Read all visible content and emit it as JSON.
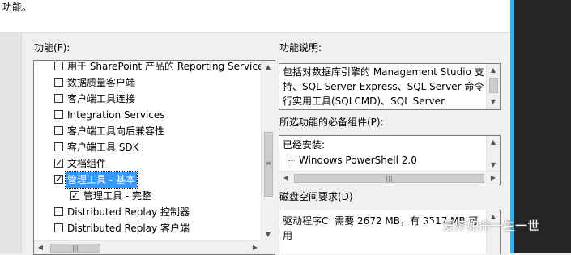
{
  "top_text": "功能。",
  "features_label": "功能(F):",
  "features": [
    {
      "label": "用于 SharePoint 产品的 Reporting Services",
      "checked": false,
      "indent": 0,
      "selected": false
    },
    {
      "label": "数据质量客户端",
      "checked": false,
      "indent": 0,
      "selected": false
    },
    {
      "label": "客户端工具连接",
      "checked": false,
      "indent": 0,
      "selected": false
    },
    {
      "label": "Integration Services",
      "checked": false,
      "indent": 0,
      "selected": false
    },
    {
      "label": "客户端工具向后兼容性",
      "checked": false,
      "indent": 0,
      "selected": false
    },
    {
      "label": "客户端工具 SDK",
      "checked": false,
      "indent": 0,
      "selected": false
    },
    {
      "label": "文档组件",
      "checked": true,
      "indent": 0,
      "selected": false
    },
    {
      "label": "管理工具 - 基本",
      "checked": true,
      "indent": 0,
      "selected": true
    },
    {
      "label": "管理工具 - 完整",
      "checked": true,
      "indent": 1,
      "selected": false
    },
    {
      "label": "Distributed Replay 控制器",
      "checked": false,
      "indent": 0,
      "selected": false
    },
    {
      "label": "Distributed Replay 客户端",
      "checked": false,
      "indent": 0,
      "selected": false
    }
  ],
  "description_label": "功能说明:",
  "description_lines": [
    "包括对数据库引擎的 Management Studio 支",
    "持、SQL Server Express、SQL Server 命令",
    "行实用工具(SQLCMD)、SQL Server"
  ],
  "prereq_label": "所选功能的必备组件(P):",
  "prereq_header": "已经安装:",
  "prereq_item": "Windows PowerShell 2.0",
  "disk_label": "磁盘空间要求(D)",
  "disk_lines": [
    "驱动程序C: 需要 2672 MB，有 3517 MB 可",
    "用"
  ],
  "watermark_text": "爱婷如命一生一世"
}
